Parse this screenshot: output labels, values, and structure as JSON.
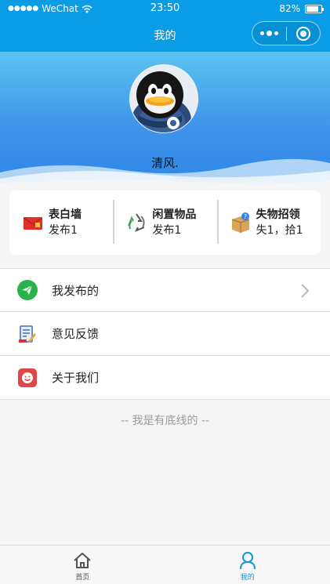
{
  "status_bar": {
    "carrier": "WeChat",
    "time": "23:50",
    "battery": "82%",
    "battery_level": 0.82
  },
  "nav": {
    "title": "我的"
  },
  "profile": {
    "username": "清风."
  },
  "stats": [
    {
      "title": "表白墙",
      "sub": "发布1",
      "icon": "envelope-icon"
    },
    {
      "title": "闲置物品",
      "sub": "发布1",
      "icon": "recycle-icon"
    },
    {
      "title": "失物招领",
      "sub": "失1，拾1",
      "icon": "box-icon"
    }
  ],
  "menu": [
    {
      "label": "我发布的",
      "icon": "paper-plane-icon"
    },
    {
      "label": "意见反馈",
      "icon": "feedback-icon"
    },
    {
      "label": "关于我们",
      "icon": "smile-icon"
    }
  ],
  "footer_note": "-- 我是有底线的 --",
  "tabbar": {
    "home_label": "首页",
    "mine_label": "我的"
  },
  "colors": {
    "primary": "#0a9de6",
    "tab_active": "#1296db"
  }
}
